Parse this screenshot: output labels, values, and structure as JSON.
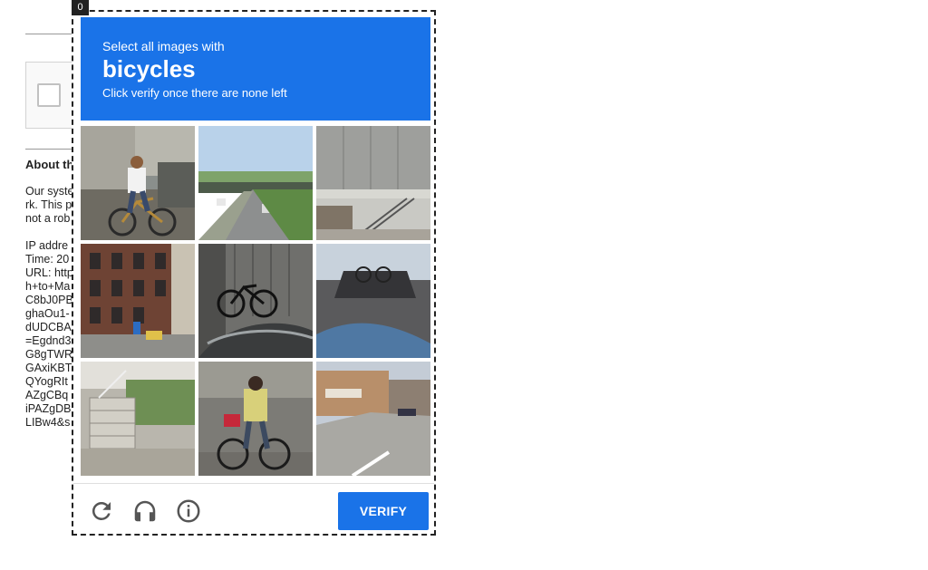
{
  "background_page": {
    "about_heading": "About th",
    "paragraph_lines": [
      "Our syste",
      "rk. This p",
      "not a rob"
    ],
    "info_lines": [
      "IP addre",
      "Time: 20",
      "URL: http",
      "h+to+Ma",
      "C8bJ0PB",
      "ghaOu1-",
      "dUDCBA",
      "=Egdnd3",
      "G8gTWR",
      "GAxiKBT",
      "QYogRIt",
      "AZgCBq",
      "iPAZgDB",
      "LIBw4&s"
    ]
  },
  "challenge": {
    "badge": "0",
    "instruction_line1": "Select all images with",
    "target_object": "bicycles",
    "instruction_line3": "Click verify once there are none left",
    "tiles": [
      {
        "label": "cyclist on street"
      },
      {
        "label": "highway with overpass"
      },
      {
        "label": "building with stairs"
      },
      {
        "label": "brick apartment buildings"
      },
      {
        "label": "bicycle parked indoors"
      },
      {
        "label": "shadow of cyclist on asphalt"
      },
      {
        "label": "concrete steps"
      },
      {
        "label": "woman riding bicycle"
      },
      {
        "label": "street with shops"
      }
    ],
    "verify_label": "VERIFY",
    "icons": {
      "reload": "reload-icon",
      "audio": "headphones-icon",
      "info": "info-icon"
    },
    "colors": {
      "accent": "#1a73e8"
    }
  }
}
